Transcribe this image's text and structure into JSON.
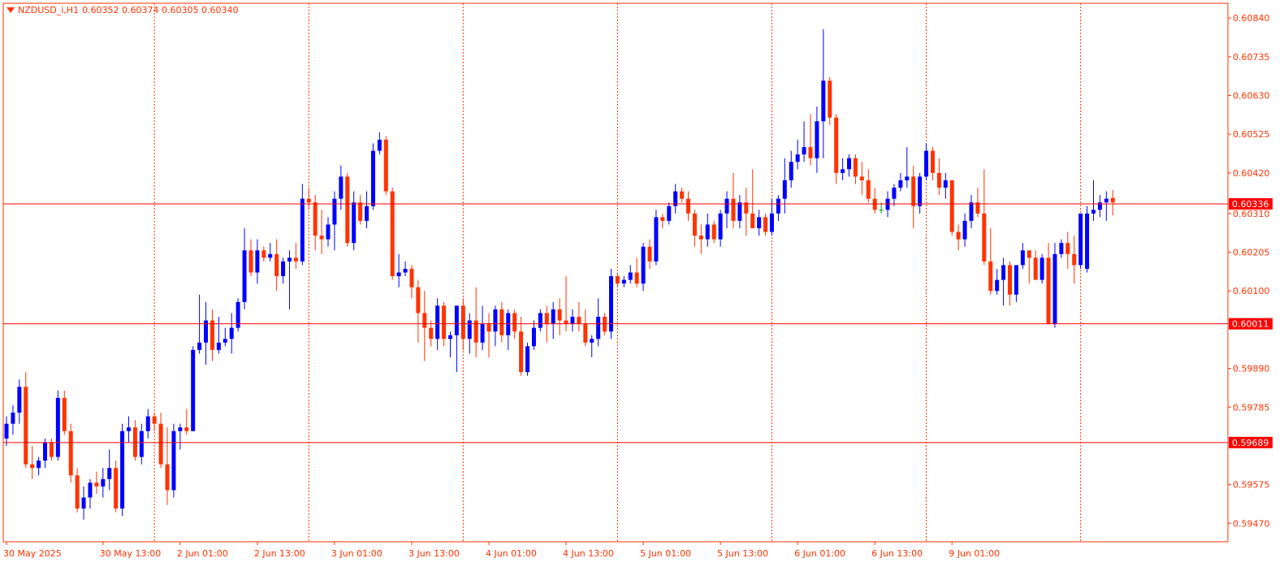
{
  "header": {
    "symbol": "NZDUSD_i,H1",
    "ohlc": "0.60352 0.60374 0.60305 0.60340"
  },
  "colors": {
    "up": "#0000ff",
    "down": "#ff3300",
    "axis": "#ff3300",
    "grid": "#ff3300",
    "level_line": "#ff0000",
    "doji": "#00aa00"
  },
  "chart_data": {
    "type": "candlestick",
    "symbol": "NZDUSD_i",
    "timeframe": "H1",
    "ylim": [
      0.5942,
      0.6088
    ],
    "y_ticks": [
      "0.60840",
      "0.60735",
      "0.60630",
      "0.60525",
      "0.60420",
      "0.60310",
      "0.60205",
      "0.60100",
      "0.59890",
      "0.59785",
      "0.59575",
      "0.59470"
    ],
    "x_labels": [
      {
        "index": 0,
        "label": "30 May 2025"
      },
      {
        "index": 15,
        "label": "30 May 13:00"
      },
      {
        "index": 27,
        "label": "2 Jun 01:00"
      },
      {
        "index": 39,
        "label": "2 Jun 13:00"
      },
      {
        "index": 51,
        "label": "3 Jun 01:00"
      },
      {
        "index": 63,
        "label": "3 Jun 13:00"
      },
      {
        "index": 75,
        "label": "4 Jun 01:00"
      },
      {
        "index": 87,
        "label": "4 Jun 13:00"
      },
      {
        "index": 99,
        "label": "5 Jun 01:00"
      },
      {
        "index": 111,
        "label": "5 Jun 13:00"
      },
      {
        "index": 123,
        "label": "6 Jun 01:00"
      },
      {
        "index": 135,
        "label": "6 Jun 13:00"
      },
      {
        "index": 147,
        "label": "9 Jun 01:00"
      }
    ],
    "grid_indices": [
      23,
      47,
      71,
      95,
      119,
      143,
      167
    ],
    "horizontal_levels": [
      "0.60336",
      "0.60011",
      "0.59689"
    ],
    "ohlc": [
      [
        0.597,
        0.5976,
        0.5968,
        0.5974
      ],
      [
        0.5974,
        0.5979,
        0.5971,
        0.5977
      ],
      [
        0.5977,
        0.5986,
        0.5974,
        0.5984
      ],
      [
        0.5984,
        0.5988,
        0.5962,
        0.5963
      ],
      [
        0.5963,
        0.5968,
        0.5959,
        0.5962
      ],
      [
        0.5962,
        0.5965,
        0.596,
        0.5964
      ],
      [
        0.5964,
        0.597,
        0.5962,
        0.5969
      ],
      [
        0.5969,
        0.597,
        0.5964,
        0.5965
      ],
      [
        0.5965,
        0.5983,
        0.5964,
        0.5981
      ],
      [
        0.5981,
        0.5983,
        0.5971,
        0.5972
      ],
      [
        0.5972,
        0.5974,
        0.5958,
        0.596
      ],
      [
        0.596,
        0.5962,
        0.595,
        0.5951
      ],
      [
        0.5951,
        0.5957,
        0.5948,
        0.5954
      ],
      [
        0.5954,
        0.5959,
        0.5951,
        0.5958
      ],
      [
        0.5958,
        0.5961,
        0.5955,
        0.5957
      ],
      [
        0.5957,
        0.5962,
        0.5954,
        0.5959
      ],
      [
        0.5959,
        0.5967,
        0.5956,
        0.5962
      ],
      [
        0.5962,
        0.5964,
        0.595,
        0.5951
      ],
      [
        0.5951,
        0.5974,
        0.5949,
        0.5972
      ],
      [
        0.5972,
        0.5976,
        0.5969,
        0.5973
      ],
      [
        0.5973,
        0.5975,
        0.5964,
        0.5965
      ],
      [
        0.5965,
        0.5974,
        0.5963,
        0.5972
      ],
      [
        0.5972,
        0.5978,
        0.597,
        0.5976
      ],
      [
        0.5976,
        0.5977,
        0.5972,
        0.5974
      ],
      [
        0.5974,
        0.5977,
        0.5962,
        0.5963
      ],
      [
        0.5963,
        0.5973,
        0.5952,
        0.5956
      ],
      [
        0.5956,
        0.5974,
        0.5954,
        0.5972
      ],
      [
        0.5972,
        0.5974,
        0.5967,
        0.5973
      ],
      [
        0.5973,
        0.5978,
        0.5971,
        0.5972
      ],
      [
        0.5972,
        0.5995,
        0.5972,
        0.5994
      ],
      [
        0.5994,
        0.6009,
        0.5993,
        0.5996
      ],
      [
        0.5996,
        0.6007,
        0.599,
        0.6002
      ],
      [
        0.6002,
        0.6005,
        0.5991,
        0.5994
      ],
      [
        0.5994,
        0.6003,
        0.5993,
        0.5996
      ],
      [
        0.5996,
        0.6,
        0.5995,
        0.5997
      ],
      [
        0.5997,
        0.6004,
        0.5993,
        0.6
      ],
      [
        0.6,
        0.6008,
        0.5999,
        0.6007
      ],
      [
        0.6007,
        0.6027,
        0.6005,
        0.6021
      ],
      [
        0.6021,
        0.6024,
        0.6014,
        0.6015
      ],
      [
        0.6015,
        0.6024,
        0.6012,
        0.6021
      ],
      [
        0.6021,
        0.6022,
        0.6018,
        0.6019
      ],
      [
        0.6019,
        0.6023,
        0.6018,
        0.602
      ],
      [
        0.602,
        0.6024,
        0.601,
        0.6014
      ],
      [
        0.6014,
        0.6019,
        0.6012,
        0.6018
      ],
      [
        0.6018,
        0.6021,
        0.6005,
        0.6019
      ],
      [
        0.6019,
        0.6023,
        0.6016,
        0.6018
      ],
      [
        0.6018,
        0.6039,
        0.6017,
        0.6035
      ],
      [
        0.6035,
        0.6038,
        0.6032,
        0.6034
      ],
      [
        0.6034,
        0.6036,
        0.6021,
        0.6025
      ],
      [
        0.6025,
        0.6032,
        0.602,
        0.6024
      ],
      [
        0.6024,
        0.603,
        0.6022,
        0.6028
      ],
      [
        0.6028,
        0.6037,
        0.6021,
        0.6035
      ],
      [
        0.6035,
        0.6044,
        0.6032,
        0.6041
      ],
      [
        0.6041,
        0.6042,
        0.6022,
        0.6023
      ],
      [
        0.6023,
        0.6037,
        0.6021,
        0.6034
      ],
      [
        0.6034,
        0.6036,
        0.6028,
        0.6029
      ],
      [
        0.6029,
        0.6037,
        0.6027,
        0.6033
      ],
      [
        0.6033,
        0.605,
        0.6032,
        0.6048
      ],
      [
        0.6048,
        0.6053,
        0.6047,
        0.6051
      ],
      [
        0.6051,
        0.6052,
        0.6036,
        0.6037
      ],
      [
        0.6037,
        0.6038,
        0.6013,
        0.6014
      ],
      [
        0.6014,
        0.602,
        0.6011,
        0.6015
      ],
      [
        0.6015,
        0.6018,
        0.6014,
        0.6016
      ],
      [
        0.6016,
        0.6017,
        0.6008,
        0.6011
      ],
      [
        0.6011,
        0.6013,
        0.5996,
        0.6004
      ],
      [
        0.6004,
        0.601,
        0.5991,
        0.6
      ],
      [
        0.6,
        0.6002,
        0.5995,
        0.5997
      ],
      [
        0.5997,
        0.6008,
        0.5994,
        0.6006
      ],
      [
        0.6006,
        0.6007,
        0.5995,
        0.5997
      ],
      [
        0.5997,
        0.5999,
        0.5992,
        0.5998
      ],
      [
        0.5998,
        0.6006,
        0.5988,
        0.6006
      ],
      [
        0.6006,
        0.6008,
        0.5994,
        0.5997
      ],
      [
        0.5997,
        0.6004,
        0.5993,
        0.6002
      ],
      [
        0.6002,
        0.6011,
        0.5992,
        0.5996
      ],
      [
        0.5996,
        0.6006,
        0.5994,
        0.6001
      ],
      [
        0.6001,
        0.6004,
        0.5992,
        0.5999
      ],
      [
        0.5999,
        0.6006,
        0.5995,
        0.6005
      ],
      [
        0.6005,
        0.6007,
        0.5996,
        0.5998
      ],
      [
        0.5998,
        0.6005,
        0.5994,
        0.6004
      ],
      [
        0.6004,
        0.6005,
        0.5997,
        0.5999
      ],
      [
        0.5999,
        0.6003,
        0.5987,
        0.5988
      ],
      [
        0.5988,
        0.5996,
        0.5987,
        0.5995
      ],
      [
        0.5995,
        0.6002,
        0.5994,
        0.6
      ],
      [
        0.6,
        0.6005,
        0.5999,
        0.6004
      ],
      [
        0.6004,
        0.6006,
        0.5996,
        0.6001
      ],
      [
        0.6001,
        0.6007,
        0.5997,
        0.6005
      ],
      [
        0.6005,
        0.6008,
        0.5998,
        0.6002
      ],
      [
        0.6002,
        0.6014,
        0.5999,
        0.6001
      ],
      [
        0.6001,
        0.6005,
        0.5999,
        0.6003
      ],
      [
        0.6003,
        0.6007,
        0.5999,
        0.6001
      ],
      [
        0.6001,
        0.6005,
        0.5995,
        0.5996
      ],
      [
        0.5996,
        0.5998,
        0.5992,
        0.5997
      ],
      [
        0.5997,
        0.6008,
        0.5995,
        0.6003
      ],
      [
        0.6003,
        0.6004,
        0.5998,
        0.5999
      ],
      [
        0.5999,
        0.6016,
        0.5997,
        0.6014
      ],
      [
        0.6014,
        0.6015,
        0.6011,
        0.6012
      ],
      [
        0.6012,
        0.6014,
        0.6011,
        0.6013
      ],
      [
        0.6013,
        0.6017,
        0.6012,
        0.6015
      ],
      [
        0.6015,
        0.6019,
        0.6011,
        0.6012
      ],
      [
        0.6012,
        0.6023,
        0.601,
        0.6022
      ],
      [
        0.6022,
        0.6024,
        0.6016,
        0.6018
      ],
      [
        0.6018,
        0.6032,
        0.6017,
        0.603
      ],
      [
        0.603,
        0.6031,
        0.6027,
        0.6029
      ],
      [
        0.6029,
        0.6034,
        0.6028,
        0.6033
      ],
      [
        0.6033,
        0.6039,
        0.6031,
        0.6037
      ],
      [
        0.6037,
        0.6038,
        0.6034,
        0.6035
      ],
      [
        0.6035,
        0.6037,
        0.6029,
        0.6031
      ],
      [
        0.6031,
        0.6032,
        0.6022,
        0.6025
      ],
      [
        0.6025,
        0.6028,
        0.602,
        0.6024
      ],
      [
        0.6024,
        0.6031,
        0.6022,
        0.6028
      ],
      [
        0.6028,
        0.6029,
        0.6023,
        0.6024
      ],
      [
        0.6024,
        0.6032,
        0.6022,
        0.6031
      ],
      [
        0.6031,
        0.6037,
        0.6027,
        0.6035
      ],
      [
        0.6035,
        0.6042,
        0.6027,
        0.6029
      ],
      [
        0.6029,
        0.6036,
        0.6027,
        0.6034
      ],
      [
        0.6034,
        0.6038,
        0.6025,
        0.6031
      ],
      [
        0.6031,
        0.6043,
        0.6028,
        0.6027
      ],
      [
        0.6027,
        0.6032,
        0.6025,
        0.603
      ],
      [
        0.603,
        0.6031,
        0.6025,
        0.6026
      ],
      [
        0.6026,
        0.6035,
        0.6025,
        0.6031
      ],
      [
        0.6031,
        0.6036,
        0.6029,
        0.6035
      ],
      [
        0.6035,
        0.6046,
        0.6031,
        0.604
      ],
      [
        0.604,
        0.6048,
        0.6038,
        0.6045
      ],
      [
        0.6045,
        0.6051,
        0.6043,
        0.6047
      ],
      [
        0.6047,
        0.6056,
        0.6045,
        0.6049
      ],
      [
        0.6049,
        0.6058,
        0.6044,
        0.6046
      ],
      [
        0.6046,
        0.606,
        0.6042,
        0.6056
      ],
      [
        0.6056,
        0.6081,
        0.6046,
        0.6067
      ],
      [
        0.6067,
        0.6068,
        0.6055,
        0.6057
      ],
      [
        0.6057,
        0.6058,
        0.6039,
        0.6042
      ],
      [
        0.6042,
        0.6046,
        0.604,
        0.6043
      ],
      [
        0.6043,
        0.6047,
        0.6041,
        0.6046
      ],
      [
        0.6046,
        0.6047,
        0.6039,
        0.6041
      ],
      [
        0.6041,
        0.6045,
        0.6036,
        0.604
      ],
      [
        0.604,
        0.6043,
        0.6034,
        0.6035
      ],
      [
        0.6035,
        0.6038,
        0.6031,
        0.6032
      ],
      [
        0.6032,
        0.6034,
        0.6031,
        0.6032
      ],
      [
        0.6032,
        0.6037,
        0.603,
        0.6035
      ],
      [
        0.6035,
        0.6039,
        0.6033,
        0.6038
      ],
      [
        0.6038,
        0.6042,
        0.6037,
        0.604
      ],
      [
        0.604,
        0.6049,
        0.6038,
        0.6041
      ],
      [
        0.6041,
        0.6044,
        0.6027,
        0.6033
      ],
      [
        0.6033,
        0.6042,
        0.6031,
        0.6041
      ],
      [
        0.6041,
        0.605,
        0.604,
        0.6048
      ],
      [
        0.6048,
        0.6049,
        0.604,
        0.6042
      ],
      [
        0.6042,
        0.6046,
        0.6036,
        0.6038
      ],
      [
        0.6038,
        0.6042,
        0.6035,
        0.604
      ],
      [
        0.604,
        0.6036,
        0.6025,
        0.6026
      ],
      [
        0.6026,
        0.6028,
        0.6021,
        0.6024
      ],
      [
        0.6024,
        0.6031,
        0.6022,
        0.6029
      ],
      [
        0.6029,
        0.6036,
        0.6027,
        0.6034
      ],
      [
        0.6034,
        0.6038,
        0.603,
        0.6031
      ],
      [
        0.6031,
        0.6043,
        0.6017,
        0.6018
      ],
      [
        0.6018,
        0.6027,
        0.6009,
        0.601
      ],
      [
        0.601,
        0.6016,
        0.6009,
        0.6013
      ],
      [
        0.6013,
        0.6019,
        0.6006,
        0.6017
      ],
      [
        0.6017,
        0.6018,
        0.6006,
        0.6009
      ],
      [
        0.6009,
        0.6017,
        0.6007,
        0.6017
      ],
      [
        0.6017,
        0.6023,
        0.6016,
        0.6021
      ],
      [
        0.6021,
        0.602,
        0.6012,
        0.6019
      ],
      [
        0.6019,
        0.6021,
        0.6014,
        0.6013
      ],
      [
        0.6013,
        0.602,
        0.6012,
        0.6019
      ],
      [
        0.6019,
        0.6023,
        0.601,
        0.6001
      ],
      [
        0.6001,
        0.6023,
        0.6,
        0.602
      ],
      [
        0.602,
        0.6024,
        0.6019,
        0.6023
      ],
      [
        0.6023,
        0.6026,
        0.6016,
        0.602
      ],
      [
        0.602,
        0.6025,
        0.6012,
        0.6017
      ],
      [
        0.6017,
        0.6023,
        0.6016,
        0.6031
      ],
      [
        0.6016,
        0.6033,
        0.6015,
        0.6031
      ],
      [
        0.6031,
        0.604,
        0.6029,
        0.6032
      ],
      [
        0.6032,
        0.6036,
        0.603,
        0.6034
      ],
      [
        0.6034,
        0.6037,
        0.6029,
        0.6035
      ],
      [
        0.60352,
        0.60374,
        0.60305,
        0.6034
      ]
    ]
  }
}
